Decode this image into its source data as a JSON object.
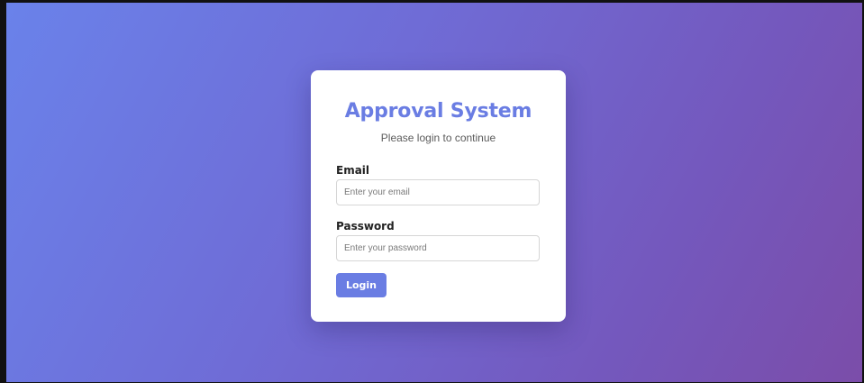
{
  "login": {
    "title": "Approval System",
    "subtitle": "Please login to continue",
    "email_label": "Email",
    "email_placeholder": "Enter your email",
    "email_value": "",
    "password_label": "Password",
    "password_placeholder": "Enter your password",
    "password_value": "",
    "login_button": "Login"
  },
  "colors": {
    "accent": "#6a7de3",
    "gradient_start": "#6a82ea",
    "gradient_end": "#7b4da9"
  }
}
